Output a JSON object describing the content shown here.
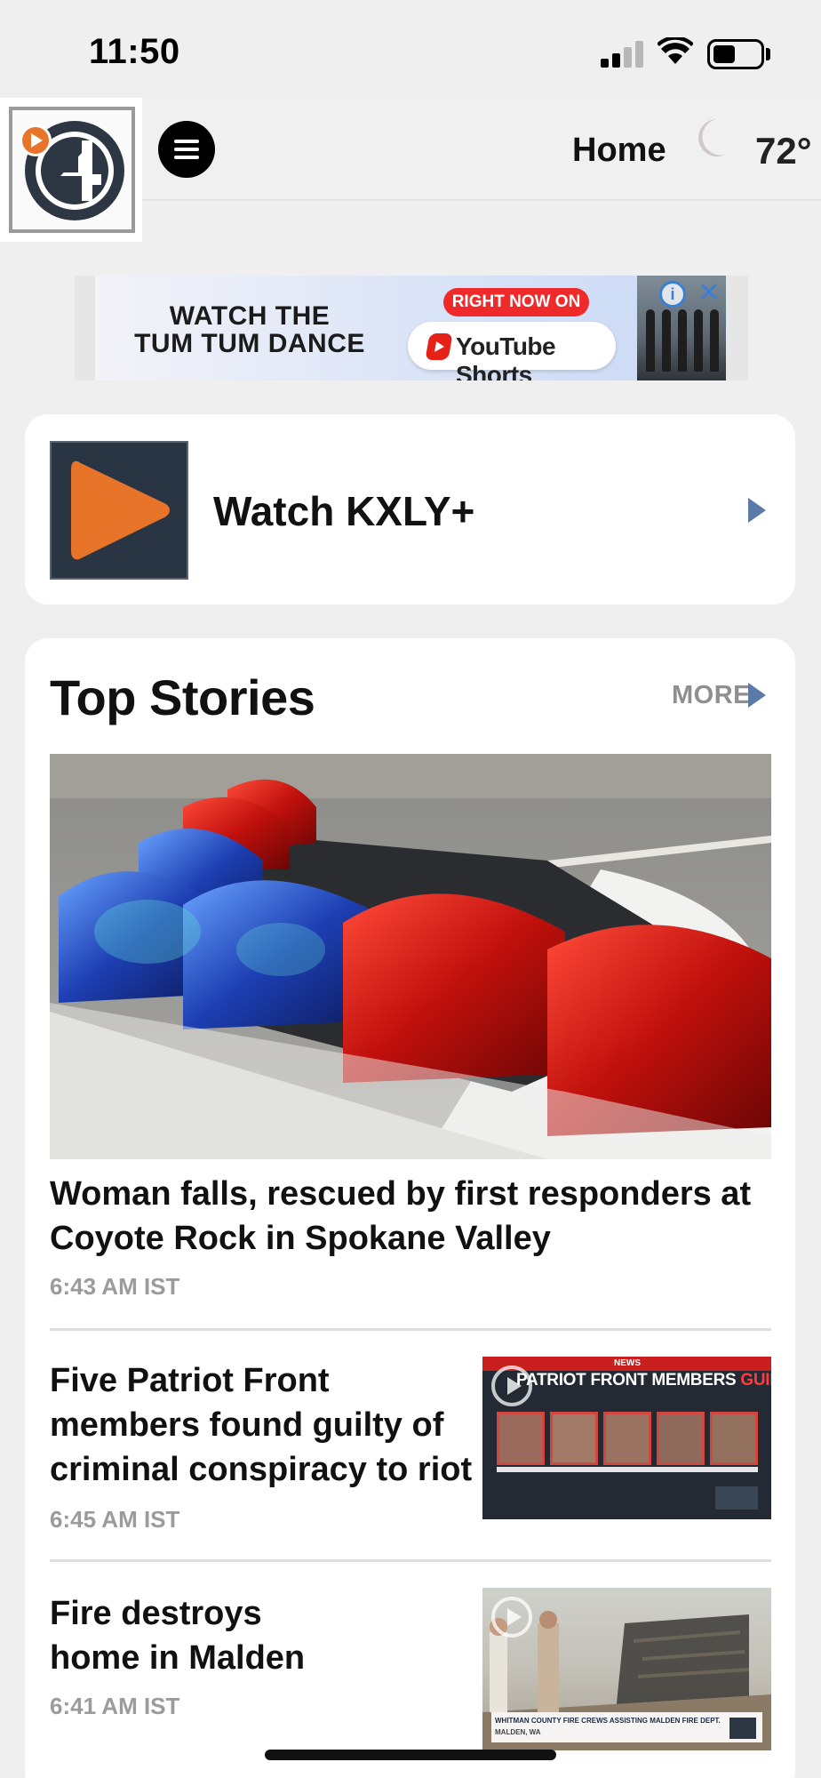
{
  "status_bar": {
    "time": "11:50"
  },
  "nav": {
    "home_label": "Home",
    "temperature": "72°"
  },
  "ad": {
    "headline_line1": "WATCH THE",
    "headline_line2": "TUM TUM DANCE",
    "pill_text": "RIGHT NOW ON",
    "platform": "YouTube Shorts",
    "info_glyph": "i",
    "close_glyph": "✕"
  },
  "watch": {
    "title": "Watch KXLY+"
  },
  "top_stories": {
    "title": "Top Stories",
    "more_label": "MORE",
    "items": [
      {
        "headline": "Woman falls, rescued by first responders at Coyote Rock in Spokane Valley",
        "time": "6:43 AM IST"
      },
      {
        "headline": "Five Patriot Front members found guilty of criminal conspiracy to riot",
        "time": "6:45 AM IST",
        "thumb_brand": "NEWS",
        "thumb_title_a": "PATRIOT FRONT MEMBERS",
        "thumb_title_b": "GUILTY"
      },
      {
        "headline": "Fire destroys home in Malden",
        "time": "6:41 AM IST",
        "thumb_caption": "WHITMAN COUNTY FIRE CREWS ASSISTING MALDEN FIRE DEPT.",
        "thumb_location": "MALDEN, WA"
      }
    ]
  },
  "colors": {
    "accent_orange": "#e8742a",
    "arrow_blue": "#5b7aa8",
    "ad_red": "#ee2a2a",
    "ad_blue": "#3a7fd6"
  },
  "icons": [
    "play-logo-icon",
    "hamburger-menu-icon",
    "moon-icon",
    "chevron-right-icon",
    "play-icon",
    "info-icon",
    "close-icon"
  ]
}
